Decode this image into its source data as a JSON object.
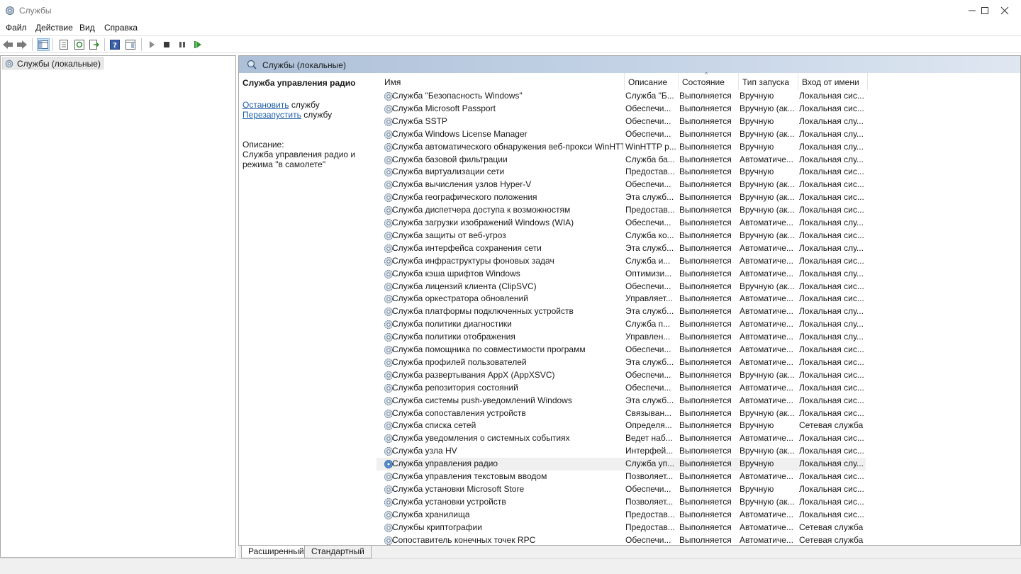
{
  "window": {
    "title": "Службы"
  },
  "menu": [
    "Файл",
    "Действие",
    "Вид",
    "Справка"
  ],
  "tree": {
    "root_label": "Службы (локальные)"
  },
  "main_header": {
    "title": "Службы (локальные)"
  },
  "extended": {
    "title": "Служба управления радио",
    "stop_link": "Остановить",
    "stop_suffix": " службу",
    "restart_link": "Перезапустить",
    "restart_suffix": " службу",
    "description_label": "Описание:",
    "description_line1": "Служба управления радио и",
    "description_line2": "режима \"в самолете\""
  },
  "columns": [
    "Имя",
    "Описание",
    "Состояние",
    "Тип запуска",
    "Вход от имени"
  ],
  "rows": [
    [
      "Служба \"Безопасность Windows\"",
      "Служба \"Б...",
      "Выполняется",
      "Вручную",
      "Локальная сис..."
    ],
    [
      "Служба Microsoft Passport",
      "Обеспечи...",
      "Выполняется",
      "Вручную (ак...",
      "Локальная сис..."
    ],
    [
      "Служба SSTP",
      "Обеспечи...",
      "Выполняется",
      "Вручную",
      "Локальная слу..."
    ],
    [
      "Служба Windows License Manager",
      "Обеспечи...",
      "Выполняется",
      "Вручную (ак...",
      "Локальная слу..."
    ],
    [
      "Служба автоматического обнаружения веб-прокси WinHTTP",
      "WinHTTP р...",
      "Выполняется",
      "Вручную",
      "Локальная слу..."
    ],
    [
      "Служба базовой фильтрации",
      "Служба ба...",
      "Выполняется",
      "Автоматиче...",
      "Локальная слу..."
    ],
    [
      "Служба виртуализации сети",
      "Предостав...",
      "Выполняется",
      "Вручную",
      "Локальная сис..."
    ],
    [
      "Служба вычисления узлов Hyper-V",
      "Обеспечи...",
      "Выполняется",
      "Вручную (ак...",
      "Локальная сис..."
    ],
    [
      "Служба географического положения",
      "Эта служб...",
      "Выполняется",
      "Вручную (ак...",
      "Локальная сис..."
    ],
    [
      "Служба диспетчера доступа к возможностям",
      "Предостав...",
      "Выполняется",
      "Вручную (ак...",
      "Локальная сис..."
    ],
    [
      "Служба загрузки изображений Windows (WIA)",
      "Обеспечи...",
      "Выполняется",
      "Автоматиче...",
      "Локальная слу..."
    ],
    [
      "Служба защиты от веб-угроз",
      "Служба ко...",
      "Выполняется",
      "Вручную (ак...",
      "Локальная сис..."
    ],
    [
      "Служба интерфейса сохранения сети",
      "Эта служб...",
      "Выполняется",
      "Автоматиче...",
      "Локальная слу..."
    ],
    [
      "Служба инфраструктуры фоновых задач",
      "Служба и...",
      "Выполняется",
      "Автоматиче...",
      "Локальная сис..."
    ],
    [
      "Служба кэша шрифтов Windows",
      "Оптимизи...",
      "Выполняется",
      "Автоматиче...",
      "Локальная слу..."
    ],
    [
      "Служба лицензий клиента (ClipSVC)",
      "Обеспечи...",
      "Выполняется",
      "Вручную (ак...",
      "Локальная сис..."
    ],
    [
      "Служба оркестратора обновлений",
      "Управляет...",
      "Выполняется",
      "Автоматиче...",
      "Локальная сис..."
    ],
    [
      "Служба платформы подключенных устройств",
      "Эта служб...",
      "Выполняется",
      "Автоматиче...",
      "Локальная слу..."
    ],
    [
      "Служба политики диагностики",
      "Служба п...",
      "Выполняется",
      "Автоматиче...",
      "Локальная слу..."
    ],
    [
      "Служба политики отображения",
      "Управлен...",
      "Выполняется",
      "Автоматиче...",
      "Локальная слу..."
    ],
    [
      "Служба помощника по совместимости программ",
      "Обеспечи...",
      "Выполняется",
      "Автоматиче...",
      "Локальная сис..."
    ],
    [
      "Служба профилей пользователей",
      "Эта служб...",
      "Выполняется",
      "Автоматиче...",
      "Локальная сис..."
    ],
    [
      "Служба развертывания AppX (AppXSVC)",
      "Обеспечи...",
      "Выполняется",
      "Вручную (ак...",
      "Локальная сис..."
    ],
    [
      "Служба репозитория состояний",
      "Обеспечи...",
      "Выполняется",
      "Автоматиче...",
      "Локальная сис..."
    ],
    [
      "Служба системы push-уведомлений Windows",
      "Эта служб...",
      "Выполняется",
      "Автоматиче...",
      "Локальная сис..."
    ],
    [
      "Служба сопоставления устройств",
      "Связыван...",
      "Выполняется",
      "Вручную (ак...",
      "Локальная сис..."
    ],
    [
      "Служба списка сетей",
      "Определя...",
      "Выполняется",
      "Вручную",
      "Сетевая служба"
    ],
    [
      "Служба уведомления о системных событиях",
      "Ведет наб...",
      "Выполняется",
      "Автоматиче...",
      "Локальная сис..."
    ],
    [
      "Служба узла HV",
      "Интерфей...",
      "Выполняется",
      "Вручную (ак...",
      "Локальная сис..."
    ],
    [
      "Служба управления радио",
      "Служба уп...",
      "Выполняется",
      "Вручную",
      "Локальная слу..."
    ],
    [
      "Служба управления текстовым вводом",
      "Позволяет...",
      "Выполняется",
      "Автоматиче...",
      "Локальная сис..."
    ],
    [
      "Служба установки Microsoft Store",
      "Обеспечи...",
      "Выполняется",
      "Вручную",
      "Локальная сис..."
    ],
    [
      "Служба установки устройств",
      "Позволяет...",
      "Выполняется",
      "Вручную (ак...",
      "Локальная сис..."
    ],
    [
      "Служба хранилища",
      "Предостав...",
      "Выполняется",
      "Автоматиче...",
      "Локальная сис..."
    ],
    [
      "Службы криптографии",
      "Предостав...",
      "Выполняется",
      "Автоматиче...",
      "Сетевая служба"
    ],
    [
      "Сопоставитель конечных точек RPC",
      "Обеспечи...",
      "Выполняется",
      "Автоматиче...",
      "Сетевая служба"
    ]
  ],
  "selected_row": "Служба управления радио",
  "tabs": [
    "Расширенный",
    "Стандартный"
  ],
  "colors": {
    "header_gradient_start": "#adc0d8",
    "link": "#1f5fa8",
    "selected_row": "#f0f0f0"
  }
}
